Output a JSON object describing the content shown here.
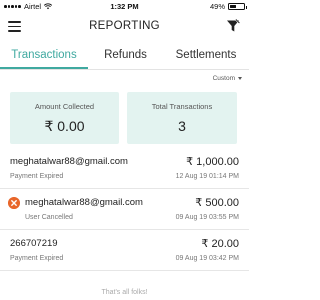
{
  "status_bar": {
    "carrier": "Airtel",
    "time": "1:32 PM",
    "battery": "49%",
    "battery_level": 0.49
  },
  "header": {
    "title": "REPORTING",
    "menu_icon": "hamburger-menu-icon",
    "filter_icon": "funnel-filter-icon"
  },
  "tabs": [
    {
      "label": "Transactions",
      "active": true
    },
    {
      "label": "Refunds",
      "active": false
    },
    {
      "label": "Settlements",
      "active": false
    }
  ],
  "filter": {
    "selected": "Custom"
  },
  "summary": {
    "amount_collected": {
      "label": "Amount Collected",
      "value": "₹ 0.00"
    },
    "total_transactions": {
      "label": "Total Transactions",
      "value": "3"
    }
  },
  "transactions": [
    {
      "name": "meghatalwar88@gmail.com",
      "status": "Payment Expired",
      "amount": "₹ 1,000.00",
      "date": "12 Aug 19 01:14 PM",
      "icon": ""
    },
    {
      "name": "meghatalwar88@gmail.com",
      "status": "User Cancelled",
      "amount": "₹ 500.00",
      "date": "09 Aug 19 03:55 PM",
      "icon": "cancel-x-icon"
    },
    {
      "name": "266707219",
      "status": "Payment Expired",
      "amount": "₹ 20.00",
      "date": "09 Aug 19 03:42 PM",
      "icon": ""
    }
  ],
  "footer": {
    "text": "That's all folks!"
  },
  "colors": {
    "accent": "#3fa9a0",
    "card_bg": "#e3f3f0",
    "cancel": "#e8662a"
  }
}
